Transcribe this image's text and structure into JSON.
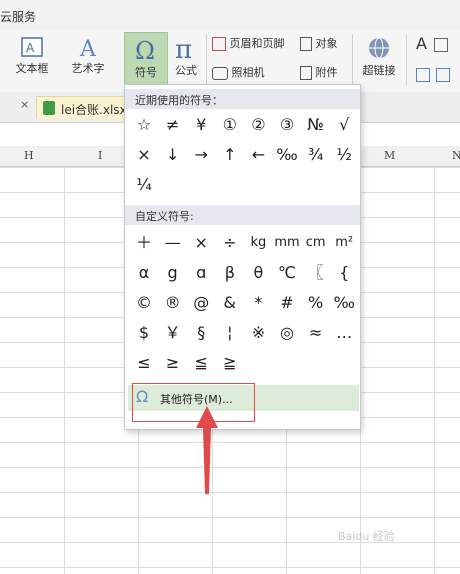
{
  "topbar": {
    "title": "云服务"
  },
  "ribbon": {
    "textbox": "文本框",
    "wordart": "艺术字",
    "symbol": "符号",
    "formula": "公式",
    "header_footer": "页眉和页脚",
    "object": "对象",
    "camera": "照相机",
    "attachment": "附件",
    "hyperlink": "超链接",
    "partial_right": "A"
  },
  "tab": {
    "filename": "lei合账.xlsx",
    "close": "×"
  },
  "columns": [
    "H",
    "I",
    "M",
    "N"
  ],
  "dropdown": {
    "recent_title": "近期使用的符号：",
    "recent_symbols": [
      "☆",
      "≠",
      "¥",
      "①",
      "②",
      "③",
      "№",
      "√",
      "×",
      "↓",
      "→",
      "↑",
      "←",
      "‰",
      "¾",
      "½",
      "¼"
    ],
    "custom_title": "自定义符号:",
    "custom_symbols": [
      "＋",
      "—",
      "×",
      "÷",
      "kg",
      "mm",
      "cm",
      "m²",
      "α",
      "g",
      "ɑ",
      "β",
      "θ",
      "℃",
      "〖",
      "{",
      "©",
      "®",
      "@",
      "&",
      "*",
      "#",
      "%",
      "‰",
      "$",
      "￥",
      "§",
      "¦",
      "※",
      "◎",
      "≈",
      "…",
      "≤",
      "≥",
      "≦",
      "≧"
    ],
    "other_button_icon": "Ω",
    "other_button": "其他符号(M)..."
  },
  "watermark": "Baidu 经验",
  "colors": {
    "highlight": "#dcebd7",
    "accent_red": "#e04a4a",
    "ribbon_blue": "#6b8fbf"
  }
}
